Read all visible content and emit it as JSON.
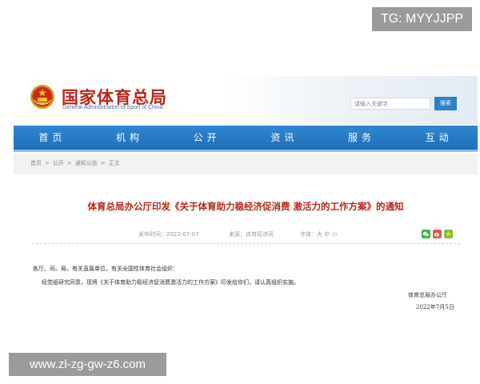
{
  "badge_text": "TG: MYYJJPP",
  "site": {
    "title": "国家体育总局",
    "subtitle": "General Administration of Sport of China"
  },
  "search": {
    "placeholder": "请输入关键字",
    "button_label": "搜索"
  },
  "nav": {
    "items": [
      "首页",
      "机构",
      "公开",
      "资讯",
      "服务",
      "互动"
    ]
  },
  "breadcrumb": {
    "items": [
      "首页",
      "公开",
      "通知公告",
      "正文"
    ],
    "separator": ">"
  },
  "article": {
    "title": "体育总局办公厅印发《关于体育助力稳经济促消费 激活力的工作方案》的通知",
    "publish_time": "发布时间：2022-07-07",
    "source": "来源：体育经济司",
    "font_size_label": "字体：",
    "font_sizes": [
      "大",
      "中",
      "小"
    ],
    "salutation": "各厅、司、局，有关直属单位，有关全国性体育社会组织：",
    "body": "经党组研究同意，现将《关于体育助力稳经济促消费激活力的工作方案》印发给你们，请认真组织实施。",
    "signature": "体育总局办公厅",
    "date": "2022年7月5日"
  },
  "share_icons": [
    "wechat-icon",
    "weibo-icon",
    "qzone-icon"
  ],
  "colors": {
    "title_red": "#b8251b",
    "nav_blue": "#2f86d1",
    "search_button_blue": "#2f7fc9",
    "wechat_green": "#3fb34f",
    "weibo_red": "#e8534a",
    "qzone_green": "#7cbf3a"
  },
  "watermark_text": "www.zl-zg-gw-z6.com"
}
